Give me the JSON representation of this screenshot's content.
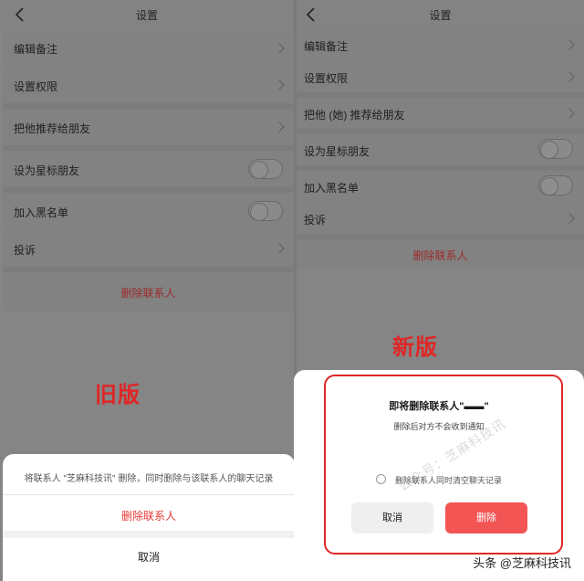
{
  "old": {
    "title": "设置",
    "items": {
      "remark": "编辑备注",
      "permission": "设置权限",
      "recommend": "把他推荐给朋友",
      "star": "设为星标朋友",
      "blacklist": "加入黑名单",
      "report": "投诉"
    },
    "delete_label": "删除联系人",
    "tag": "旧版",
    "sheet": {
      "message": "将联系人 \"芝麻科技讯\" 删除，同时删除与该联系人的聊天记录",
      "danger_label": "删除联系人",
      "cancel_label": "取消"
    }
  },
  "new": {
    "title": "设置",
    "items": {
      "remark": "编辑备注",
      "permission": "设置权限",
      "recommend": "把他 (她) 推荐给朋友",
      "star": "设为星标朋友",
      "blacklist": "加入黑名单",
      "report": "投诉"
    },
    "delete_label": "删除联系人",
    "tag": "新版",
    "modal": {
      "title": "即将删除联系人\"▬▬\"",
      "subtitle": "删除后对方不会收到通知",
      "checkbox_label": "删除联系人同时清空聊天记录",
      "checkbox_checked": false,
      "cancel_label": "取消",
      "delete_label": "删除"
    }
  },
  "watermark": "公众号：芝麻科技讯",
  "credit": "头条 @芝麻科技讯",
  "colors": {
    "danger": "#e53935",
    "tag": "#e02626",
    "delete_button": "#f35555"
  }
}
